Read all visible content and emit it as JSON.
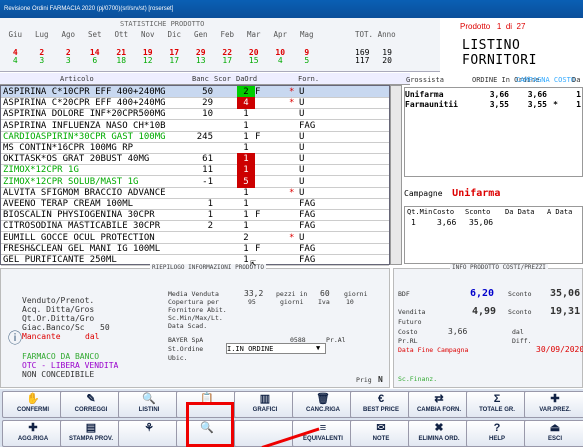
{
  "window": {
    "title": "Revisione Ordini FARMACIA 2020 (pj/0700)(srl/srv/st) [roserset]"
  },
  "stats": {
    "title": "STATISTICHE PRODOTTO",
    "months": [
      "Giu",
      "Lug",
      "Ago",
      "Set",
      "Ott",
      "Nov",
      "Dic",
      "Gen",
      "Feb",
      "Mar",
      "Apr",
      "Mag"
    ],
    "row_red": [
      "4",
      "2",
      "2",
      "14",
      "21",
      "19",
      "17",
      "29",
      "22",
      "20",
      "10",
      "9"
    ],
    "row_green": [
      "4",
      "3",
      "3",
      "6",
      "18",
      "12",
      "17",
      "13",
      "17",
      "15",
      "4",
      "5"
    ],
    "tot_label": "TOT. Anno",
    "tot_red": [
      "169",
      "19"
    ],
    "tot_green": [
      "117",
      "20"
    ]
  },
  "header_right": {
    "prodotto": "Prodotto",
    "index": "1",
    "di": "di",
    "total": "27"
  },
  "listino": {
    "title": "LISTINO FORNITORI",
    "cols": [
      "Grossista",
      "ORDINE In Ordine",
      "CAMPAGNA COSTO",
      "Da"
    ],
    "rows": [
      {
        "name": "Unifarma",
        "ordine": "3,66",
        "costo": "3,66",
        "mark": "",
        "da": "1"
      },
      {
        "name": "Farmaunitii",
        "ordine": "3,55",
        "costo": "3,55",
        "mark": "*",
        "da": "1"
      }
    ]
  },
  "articles": {
    "headers": {
      "articolo": "Articolo",
      "banc": "Banc",
      "scor": "Scor",
      "daord": "DaOrd",
      "forn": "Forn."
    },
    "rows": [
      {
        "desc": "ASPIRINA C*10CPR EFF 400+240MG",
        "banc": "50",
        "scor": "",
        "ord": "2",
        "ordc": "grn",
        "flag": "F",
        "star": "*",
        "forn": "U",
        "sel": true,
        "green": false
      },
      {
        "desc": "ASPIRINA C*20CPR EFF 400+240MG",
        "banc": "29",
        "scor": "",
        "ord": "4",
        "ordc": "red",
        "flag": "",
        "star": "*",
        "forn": "U",
        "sel": false,
        "green": false
      },
      {
        "desc": "ASPIRINA DOLORE INF*20CPR500MG",
        "banc": "10",
        "scor": "",
        "ord": "1",
        "ordc": "",
        "flag": "",
        "star": "",
        "forn": "U",
        "sel": false,
        "green": false
      },
      {
        "desc": "ASPIRINA INFLUENZA NASO CH*10B",
        "banc": "",
        "scor": "",
        "ord": "1",
        "ordc": "",
        "flag": "",
        "star": "",
        "forn": "FAG",
        "sel": false,
        "green": false
      },
      {
        "desc": "CARDIOASPIRIN*30CPR GAST 100MG",
        "banc": "245",
        "scor": "",
        "ord": "1",
        "ordc": "",
        "flag": "F",
        "star": "",
        "forn": "U",
        "sel": false,
        "green": true
      },
      {
        "desc": "MS CONTIN*16CPR 100MG RP",
        "banc": "",
        "scor": "",
        "ord": "1",
        "ordc": "",
        "flag": "",
        "star": "",
        "forn": "U",
        "sel": false,
        "green": false
      },
      {
        "desc": "OKITASK*OS GRAT 20BUST 40MG",
        "banc": "61",
        "scor": "",
        "ord": "1",
        "ordc": "red",
        "flag": "",
        "star": "",
        "forn": "U",
        "sel": false,
        "green": false
      },
      {
        "desc": "ZIMOX*12CPR 1G",
        "banc": "11",
        "scor": "",
        "ord": "1",
        "ordc": "red",
        "flag": "",
        "star": "",
        "forn": "U",
        "sel": false,
        "green": true
      },
      {
        "desc": "ZIMOX*12CPR SOLUB/MAST 1G",
        "banc": "-1",
        "scor": "",
        "ord": "5",
        "ordc": "red",
        "flag": "",
        "star": "",
        "forn": "U",
        "sel": false,
        "green": true
      },
      {
        "desc": "ALVITA SFIGMOM BRACCIO ADVANCE",
        "banc": "",
        "scor": "",
        "ord": "1",
        "ordc": "",
        "flag": "",
        "star": "*",
        "forn": "U",
        "sel": false,
        "green": false
      },
      {
        "desc": "AVEENO TERAP CREAM 100ML",
        "banc": "1",
        "scor": "",
        "ord": "1",
        "ordc": "",
        "flag": "",
        "star": "",
        "forn": "FAG",
        "sel": false,
        "green": false
      },
      {
        "desc": "BIOSCALIN PHYSIOGENINA 30CPR",
        "banc": "1",
        "scor": "",
        "ord": "1",
        "ordc": "",
        "flag": "F",
        "star": "",
        "forn": "FAG",
        "sel": false,
        "green": false
      },
      {
        "desc": "CITROSODINA MASTICABILE 30CPR",
        "banc": "2",
        "scor": "",
        "ord": "1",
        "ordc": "",
        "flag": "",
        "star": "",
        "forn": "FAG",
        "sel": false,
        "green": false
      },
      {
        "desc": "EUMILL GOCCE OCUL PROTECTION",
        "banc": "",
        "scor": "",
        "ord": "2",
        "ordc": "",
        "flag": "",
        "star": "*",
        "forn": "U",
        "sel": false,
        "green": false
      },
      {
        "desc": "FRESH&CLEAN GEL MANI IG 100ML",
        "banc": "",
        "scor": "",
        "ord": "1",
        "ordc": "",
        "flag": "F",
        "star": "",
        "forn": "FAG",
        "sel": false,
        "green": false
      },
      {
        "desc": "GEL PURIFICANTE 250ML",
        "banc": "",
        "scor": "",
        "ord": "1",
        "ordc": "",
        "flag": "",
        "star": "",
        "forn": "FAG",
        "sel": false,
        "green": false
      }
    ]
  },
  "campagne": {
    "label": "Campagne",
    "name": "Unifarma",
    "cols": [
      "Qt.Min",
      "Costo",
      "Sconto",
      "Da Data",
      "A Data"
    ],
    "row": [
      "1",
      "3,66",
      "35,06",
      "",
      ""
    ]
  },
  "info": {
    "title": "RIEPILOGO INFORMAZIONI PRODOTTO",
    "venduto": "Venduto/Prenot.",
    "acq": "Acq. Ditta/Gros",
    "qt": "Qt.Or.Ditta/Gro",
    "giac": "Giac.Banco/Sc",
    "giac_val": "50",
    "mancante": "Mancante",
    "dal": "dal",
    "media": "Media Venduta",
    "media_val": "33,2",
    "pezzi": "pezzi in",
    "giorni_val": "60",
    "giorni": "giorni",
    "copertura": "Copertura per",
    "cop_val": "95",
    "giorni2": "giorni",
    "iva": "Iva",
    "iva_val": "10",
    "fornitore": "Fornitore Abit.",
    "scmin": "Sc.Min/Max/Lt.",
    "datascad": "Data Scad.",
    "bayer": "BAYER SpA",
    "code": "0588",
    "pral": "Pr.Al",
    "stordine": "St.Ordine",
    "stordine_val": "I.IN ORDINE",
    "ubic": "Ubic.",
    "farmaco": "FARMACO DA BANCO",
    "otc": "OTC - LIBERA VENDITA",
    "nonconc": "NON CONCEDIBILE",
    "prig": "Prig",
    "prig_val": "N"
  },
  "costi": {
    "title": "INFO PRODOTTO COSTI/PREZZI",
    "bdf": "BDF",
    "bdf_val": "6,20",
    "sconto": "Sconto",
    "sconto_val": "35,06",
    "vendita": "Vendita",
    "vendita_val": "4,99",
    "sconto2": "Sconto",
    "sconto2_val": "19,31",
    "futuro": "Futuro",
    "costo": "Costo",
    "costo_val": "3,66",
    "dal": "dal",
    "prrl": "Pr.RL",
    "diff": "Diff.",
    "fine": "Data Fine Campagna",
    "fine_val": "30/09/2020",
    "scfinanz": "Sc.Finanz."
  },
  "buttons_row1": [
    {
      "name": "conferma-button",
      "label": "CONFERMI",
      "icon": "✋"
    },
    {
      "name": "corregi-button",
      "label": "CORREGGI",
      "icon": "✎"
    },
    {
      "name": "listini-button",
      "label": "LISTINI",
      "icon": "🔍"
    },
    {
      "name": "unnamed-button",
      "label": "",
      "icon": "📋"
    },
    {
      "name": "grafici-button",
      "label": "GRAFICI",
      "icon": "▥"
    },
    {
      "name": "canc-riga-button",
      "label": "CANC.RIGA",
      "icon": "🗑"
    },
    {
      "name": "best-price-button",
      "label": "BEST PRICE",
      "icon": "€"
    },
    {
      "name": "cambia-forn-button",
      "label": "CAMBIA FORN.",
      "icon": "⇄"
    },
    {
      "name": "totale-gr-button",
      "label": "TOTALE GR.",
      "icon": "Σ"
    },
    {
      "name": "var-prez-button",
      "label": "VAR.PREZ.",
      "icon": "✚"
    }
  ],
  "buttons_row2": [
    {
      "name": "agg-riga-button",
      "label": "AGG.RIGA",
      "icon": "✚"
    },
    {
      "name": "stampa-prov-button",
      "label": "STAMPA PROV.",
      "icon": "▤"
    },
    {
      "name": "unnamed2-button",
      "label": "",
      "icon": "⚘"
    },
    {
      "name": "search-button",
      "label": "",
      "icon": "🔍"
    },
    {
      "name": "unnamed3-button",
      "label": "",
      "icon": ""
    },
    {
      "name": "equivalenti-button",
      "label": "EQUIVALENTI",
      "icon": "≡"
    },
    {
      "name": "note-button",
      "label": "NOTE",
      "icon": "✉"
    },
    {
      "name": "elimina-ord-button",
      "label": "ELIMINA ORD.",
      "icon": "✖"
    },
    {
      "name": "help-button",
      "label": "HELP",
      "icon": "?"
    },
    {
      "name": "esci-button",
      "label": "ESCI",
      "icon": "⏏"
    }
  ]
}
